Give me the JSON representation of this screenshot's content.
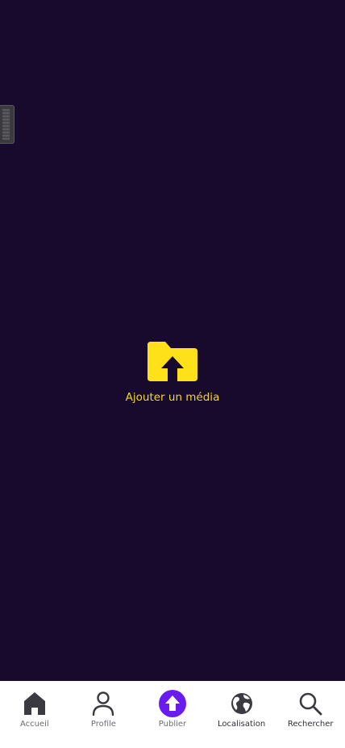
{
  "theme": {
    "background": "#170a2d",
    "accent_yellow": "#ffe11a",
    "accent_purple": "#6a1bf0",
    "nav_background": "#ffffff"
  },
  "upload": {
    "icon": "folder-upload-icon",
    "label": "Ajouter un média"
  },
  "nav": {
    "items": [
      {
        "label": "Accueil",
        "icon": "home-icon"
      },
      {
        "label": "Profile",
        "icon": "user-icon"
      },
      {
        "label": "Publier",
        "icon": "upload-arrow-icon",
        "active": true
      },
      {
        "label": "Localisation",
        "icon": "globe-icon"
      },
      {
        "label": "Rechercher",
        "icon": "search-icon"
      }
    ]
  }
}
